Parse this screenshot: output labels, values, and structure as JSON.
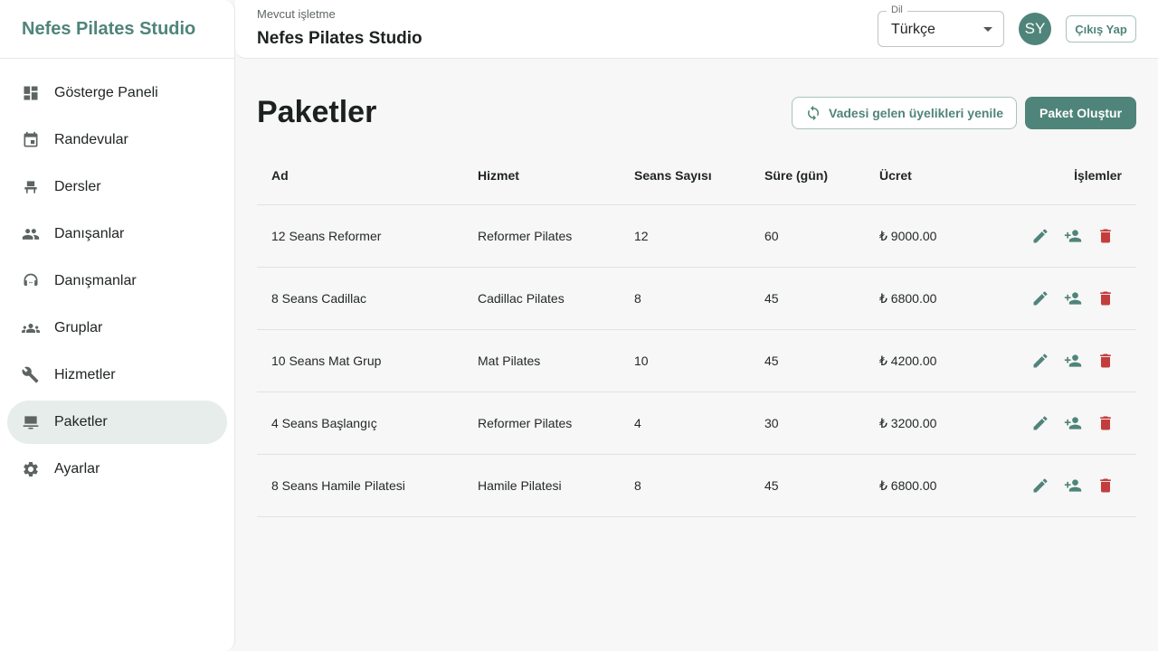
{
  "brand": "Nefes Pilates Studio",
  "nav": [
    {
      "label": "Gösterge Paneli",
      "icon": "dashboard-icon"
    },
    {
      "label": "Randevular",
      "icon": "calendar-icon"
    },
    {
      "label": "Dersler",
      "icon": "reformer-icon"
    },
    {
      "label": "Danışanlar",
      "icon": "people-icon"
    },
    {
      "label": "Danışmanlar",
      "icon": "support-agent-icon"
    },
    {
      "label": "Gruplar",
      "icon": "groups-icon"
    },
    {
      "label": "Hizmetler",
      "icon": "tools-icon"
    },
    {
      "label": "Paketler",
      "icon": "package-icon",
      "active": true
    },
    {
      "label": "Ayarlar",
      "icon": "gear-icon"
    }
  ],
  "topbar": {
    "business_caption": "Mevcut işletme",
    "business_name": "Nefes Pilates Studio",
    "language_label": "Dil",
    "language_value": "Türkçe",
    "avatar_initials": "SY",
    "logout_label": "Çıkış Yap"
  },
  "page": {
    "title": "Paketler",
    "renew_label": "Vadesi gelen üyelikleri yenile",
    "create_label": "Paket Oluştur"
  },
  "table": {
    "headers": {
      "name": "Ad",
      "service": "Hizmet",
      "sessions": "Seans Sayısı",
      "duration": "Süre (gün)",
      "price": "Ücret",
      "actions": "İşlemler"
    },
    "rows": [
      {
        "name": "12 Seans Reformer",
        "service": "Reformer Pilates",
        "sessions": "12",
        "duration": "60",
        "price": "₺ 9000.00"
      },
      {
        "name": "8 Seans Cadillac",
        "service": "Cadillac Pilates",
        "sessions": "8",
        "duration": "45",
        "price": "₺ 6800.00"
      },
      {
        "name": "10 Seans Mat Grup",
        "service": "Mat Pilates",
        "sessions": "10",
        "duration": "45",
        "price": "₺ 4200.00"
      },
      {
        "name": "4 Seans Başlangıç",
        "service": "Reformer Pilates",
        "sessions": "4",
        "duration": "30",
        "price": "₺ 3200.00"
      },
      {
        "name": "8 Seans Hamile Pilatesi",
        "service": "Hamile Pilatesi",
        "sessions": "8",
        "duration": "45",
        "price": "₺ 6800.00"
      }
    ]
  },
  "colors": {
    "accent": "#4f847a",
    "danger": "#c43d3d",
    "active_nav_bg": "#e7edeb"
  }
}
